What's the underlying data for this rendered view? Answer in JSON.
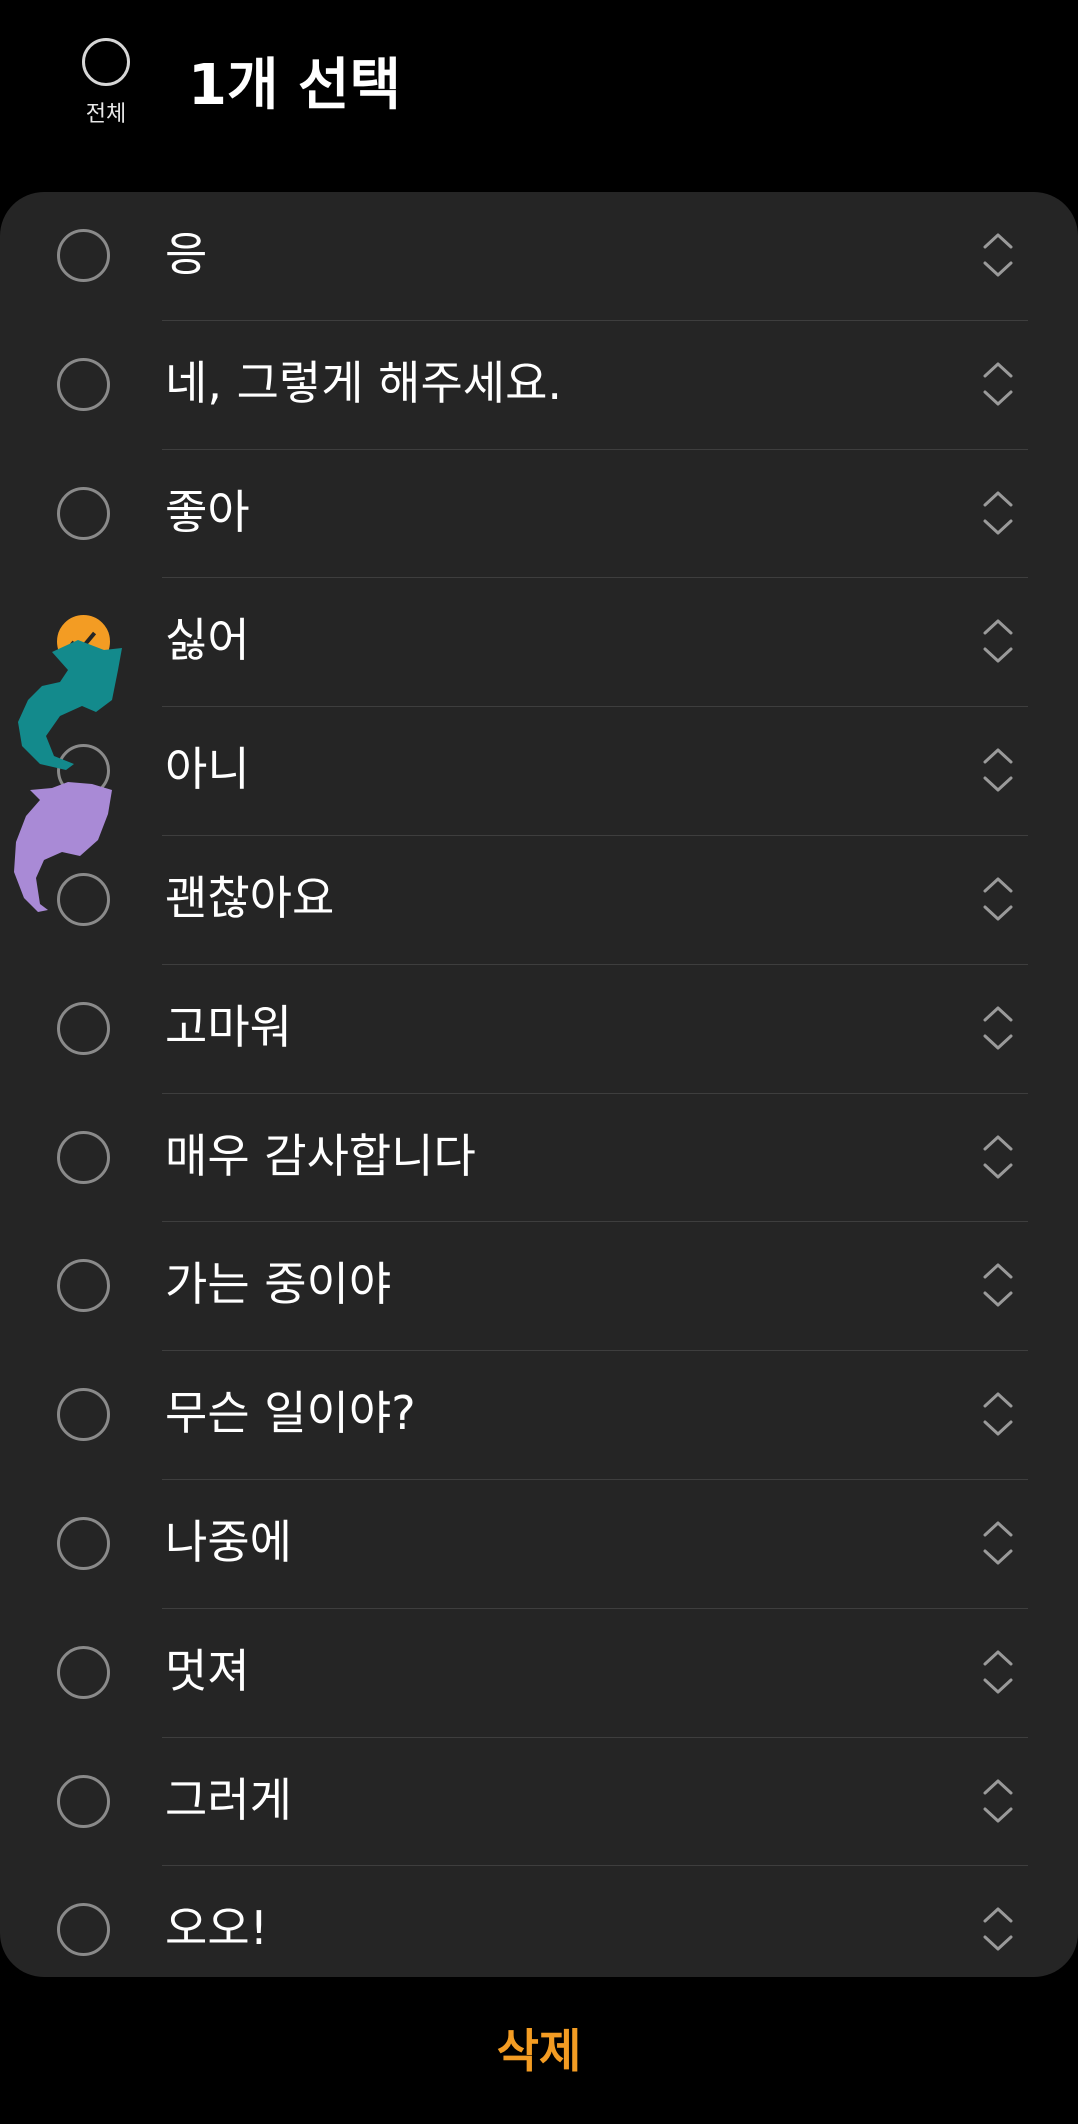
{
  "header": {
    "select_all_label": "전체",
    "title": "1개 선택"
  },
  "phrases": [
    {
      "text": "응",
      "checked": false
    },
    {
      "text": "네, 그렇게 해주세요.",
      "checked": false
    },
    {
      "text": "좋아",
      "checked": false
    },
    {
      "text": "싫어",
      "checked": true
    },
    {
      "text": "아니",
      "checked": false
    },
    {
      "text": "괜찮아요",
      "checked": false
    },
    {
      "text": "고마워",
      "checked": false
    },
    {
      "text": "매우 감사합니다",
      "checked": false
    },
    {
      "text": "가는 중이야",
      "checked": false
    },
    {
      "text": "무슨 일이야?",
      "checked": false
    },
    {
      "text": "나중에",
      "checked": false
    },
    {
      "text": "멋져",
      "checked": false
    },
    {
      "text": "그러게",
      "checked": false
    },
    {
      "text": "오오!",
      "checked": false
    }
  ],
  "bottom": {
    "delete_label": "삭제"
  },
  "colors": {
    "accent": "#f39c23",
    "card_bg": "#252525",
    "page_bg": "#000000",
    "teal_arrow": "#138a8c",
    "purple_arrow": "#a98ad6"
  },
  "icons": {
    "reorder": "reorder-handle-icon",
    "checkmark": "checkmark-icon"
  }
}
